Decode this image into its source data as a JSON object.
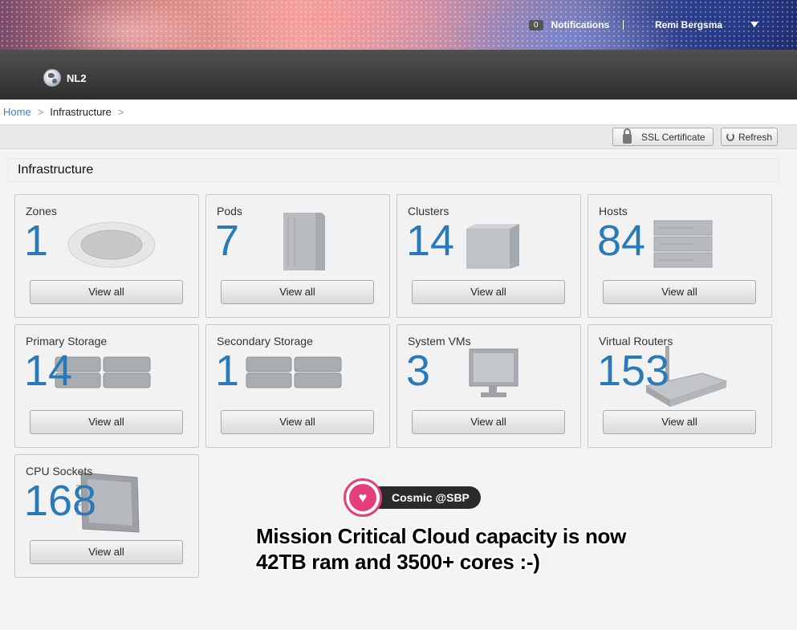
{
  "header": {
    "notifications_count": "0",
    "notifications_label": "Notifications",
    "user_name": "Remi Bergsma"
  },
  "nav": {
    "zone_name": "NL2"
  },
  "breadcrumb": {
    "home": "Home",
    "current": "Infrastructure",
    "sep": ">"
  },
  "toolbar": {
    "ssl_label": "SSL Certificate",
    "refresh_label": "Refresh"
  },
  "main": {
    "title": "Infrastructure"
  },
  "cards": [
    {
      "title": "Zones",
      "count": "1",
      "button": "View all",
      "icon": "zone-icon"
    },
    {
      "title": "Pods",
      "count": "7",
      "button": "View all",
      "icon": "pod-rack-icon"
    },
    {
      "title": "Clusters",
      "count": "14",
      "button": "View all",
      "icon": "cluster-cube-icon"
    },
    {
      "title": "Hosts",
      "count": "84",
      "button": "View all",
      "icon": "host-server-icon"
    },
    {
      "title": "Primary Storage",
      "count": "14",
      "button": "View all",
      "icon": "primary-storage-icon"
    },
    {
      "title": "Secondary Storage",
      "count": "1",
      "button": "View all",
      "icon": "secondary-storage-icon"
    },
    {
      "title": "System VMs",
      "count": "3",
      "button": "View all",
      "icon": "monitor-icon"
    },
    {
      "title": "Virtual Routers",
      "count": "153",
      "button": "View all",
      "icon": "router-icon"
    },
    {
      "title": "CPU Sockets",
      "count": "168",
      "button": "View all",
      "icon": "cpu-chip-icon"
    }
  ],
  "watermark": {
    "brand": "Cosmic @SBP",
    "caption_line1": "Mission Critical Cloud capacity is now",
    "caption_line2": "42TB ram and 3500+ cores :-)"
  }
}
